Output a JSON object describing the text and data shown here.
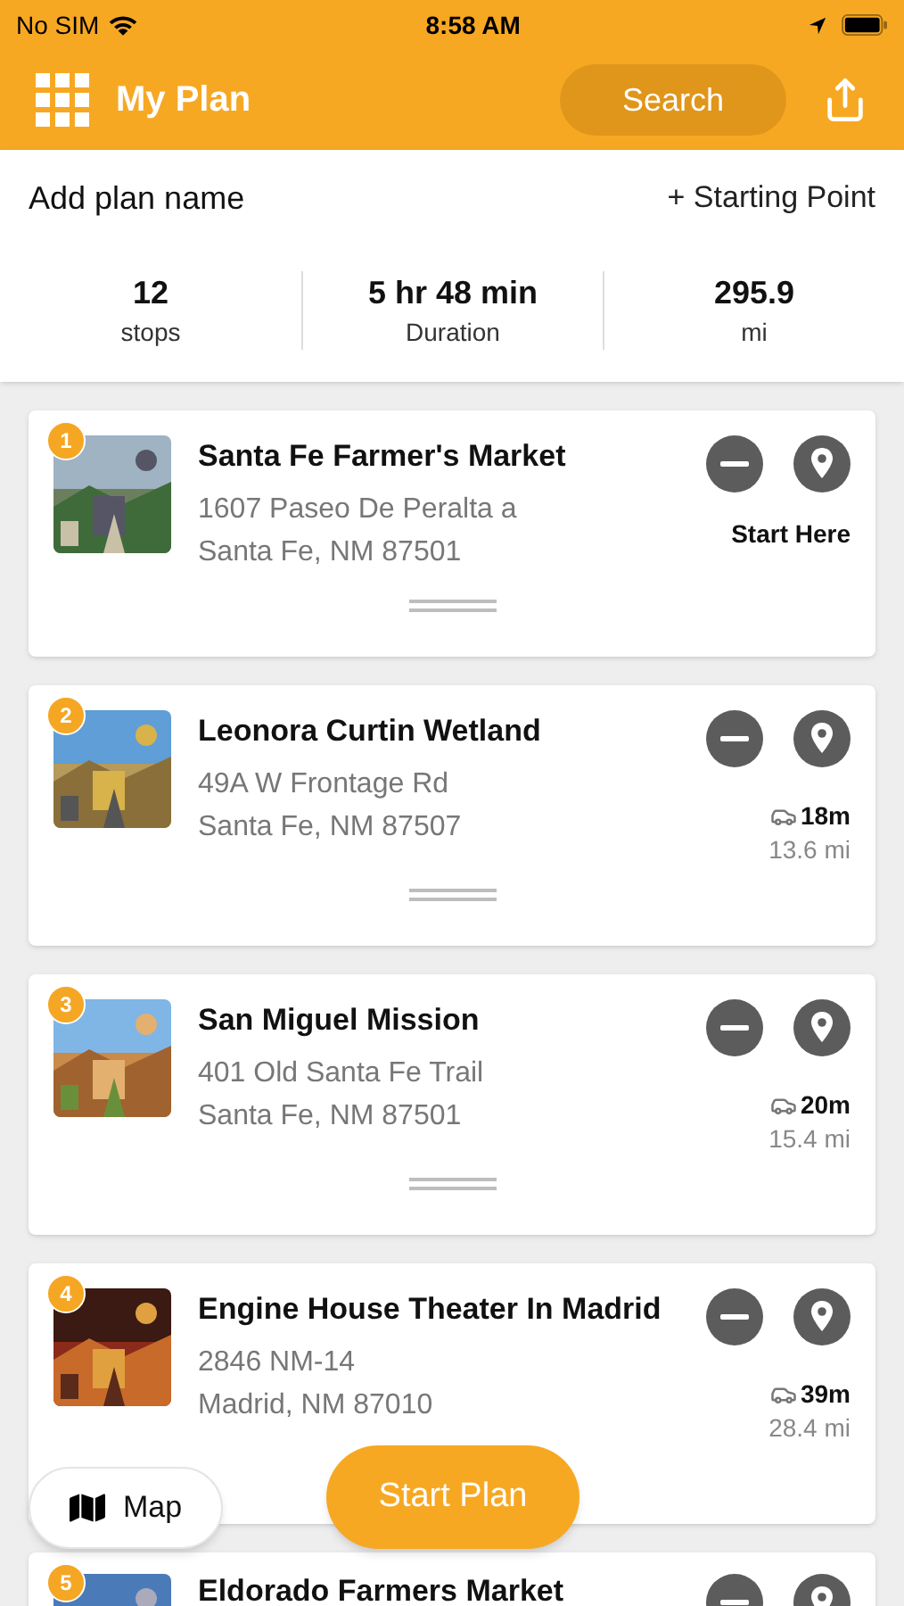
{
  "status_bar": {
    "carrier": "No SIM",
    "time": "8:58 AM"
  },
  "header": {
    "title": "My Plan",
    "search": "Search"
  },
  "plan": {
    "name_placeholder": "Add plan name",
    "starting_point": "+ Starting Point"
  },
  "stats": [
    {
      "value": "12",
      "label": "stops"
    },
    {
      "value": "5 hr 48 min",
      "label": "Duration"
    },
    {
      "value": "295.9",
      "label": "mi"
    }
  ],
  "stops": [
    {
      "number": "1",
      "kind": "start",
      "name": "Santa Fe Farmer's Market",
      "address": [
        "1607 Paseo De Peralta a",
        "Santa Fe, NM 87501"
      ],
      "note": "Start Here"
    },
    {
      "number": "2",
      "kind": "drive",
      "name": "Leonora Curtin Wetland",
      "address": [
        "49A W Frontage Rd",
        "Santa Fe, NM 87507"
      ],
      "drive_time": "18m",
      "distance": "13.6 mi"
    },
    {
      "number": "3",
      "kind": "drive",
      "name": "San Miguel Mission",
      "address": [
        "401 Old Santa Fe Trail",
        "Santa Fe, NM 87501"
      ],
      "drive_time": "20m",
      "distance": "15.4 mi"
    },
    {
      "number": "4",
      "kind": "drive",
      "name": "Engine House Theater In Madrid",
      "address": [
        "2846 NM-14",
        "Madrid, NM 87010"
      ],
      "drive_time": "39m",
      "distance": "28.4 mi"
    },
    {
      "number": "5",
      "kind": "partial",
      "name": "Eldorado Farmers Market"
    }
  ],
  "map_button": "Map",
  "start_button": "Start Plan"
}
